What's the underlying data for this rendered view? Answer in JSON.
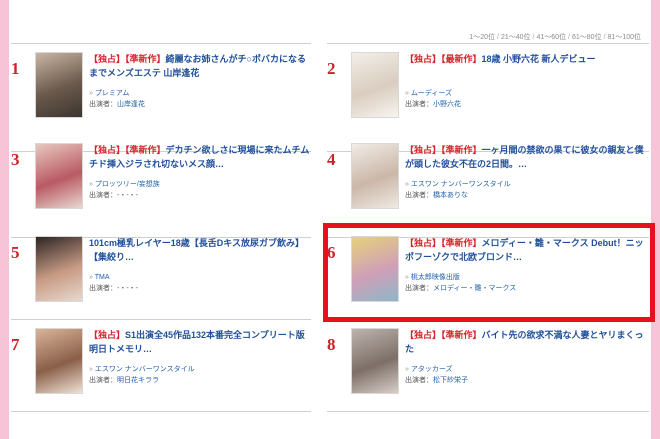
{
  "pagination": {
    "pages": [
      "1～20位",
      "21～40位",
      "41～60位",
      "61～80位",
      "81～100位"
    ],
    "separator": "/"
  },
  "actors_label": "出演者：",
  "items": [
    {
      "rank": "1",
      "tags": "【独占】【準新作】",
      "title": "綺麗なお姉さんがチ○ポバカになるまでメンズエステ 山岸逢花",
      "maker": "プレミアム",
      "actors": "山岸逢花",
      "actors_linked": true,
      "thumb_colors": [
        "#c9b5a4",
        "#6b5a4c",
        "#3d3430"
      ]
    },
    {
      "rank": "2",
      "tags": "【独占】【最新作】",
      "title": "18歳 小野六花 新人デビュー",
      "maker": "ムーディーズ",
      "actors": "小野六花",
      "actors_linked": true,
      "thumb_colors": [
        "#f3efe9",
        "#d9cdbf",
        "#f7f4ef"
      ]
    },
    {
      "rank": "3",
      "tags": "【独占】【準新作】",
      "title": "デカチン欲しさに現場に来たムチムチド挿入ジラされ切ないメス顔…",
      "maker": "プロッツリー/妄想族",
      "actors": "-・-・-",
      "actors_linked": false,
      "thumb_colors": [
        "#e9c9c0",
        "#b95a63",
        "#e8d8d0"
      ]
    },
    {
      "rank": "4",
      "tags": "【独占】【準新作】",
      "title": "一ヶ月間の禁欲の果てに彼女の親友と僕が頭した彼女不在の2日間。…",
      "maker": "エスワン ナンバーワンスタイル",
      "actors": "橋本ありな",
      "actors_linked": true,
      "thumb_colors": [
        "#f1ece6",
        "#cbb7a9",
        "#efe9e2"
      ]
    },
    {
      "rank": "5",
      "tags": "",
      "title": "101cm極乳レイヤー18歳【長舌Dキス放尿ガブ飲み】【集絞り…",
      "maker": "TMA",
      "actors": "-・-・-",
      "actors_linked": false,
      "thumb_colors": [
        "#2d2522",
        "#c79a84",
        "#e7d9cf"
      ]
    },
    {
      "rank": "6",
      "tags": "【独占】【準新作】",
      "title": "メロディー・雛・マークス Debut！ニッポフーゾクで北欧ブロンド…",
      "maker": "桃太郎映像出版",
      "actors": "メロディー・雛・マークス",
      "actors_linked": true,
      "thumb_colors": [
        "#e6d27a",
        "#cf9fb8",
        "#8fb7c8"
      ]
    },
    {
      "rank": "7",
      "tags": "【独占】",
      "title": "S1出演全45作品132本番完全コンプリート版 明日トメモリ…",
      "maker": "エスワン ナンバーワンスタイル",
      "actors": "明日花キララ",
      "actors_linked": true,
      "thumb_colors": [
        "#d9b49a",
        "#8a5f49",
        "#f0e2d6"
      ]
    },
    {
      "rank": "8",
      "tags": "【独占】【準新作】",
      "title": "バイト先の欲求不満な人妻とヤリまくった",
      "maker": "アタッカーズ",
      "actors": "松下紗栄子",
      "actors_linked": true,
      "thumb_colors": [
        "#bdb4ad",
        "#7d6f68",
        "#d8cfc8"
      ]
    }
  ]
}
